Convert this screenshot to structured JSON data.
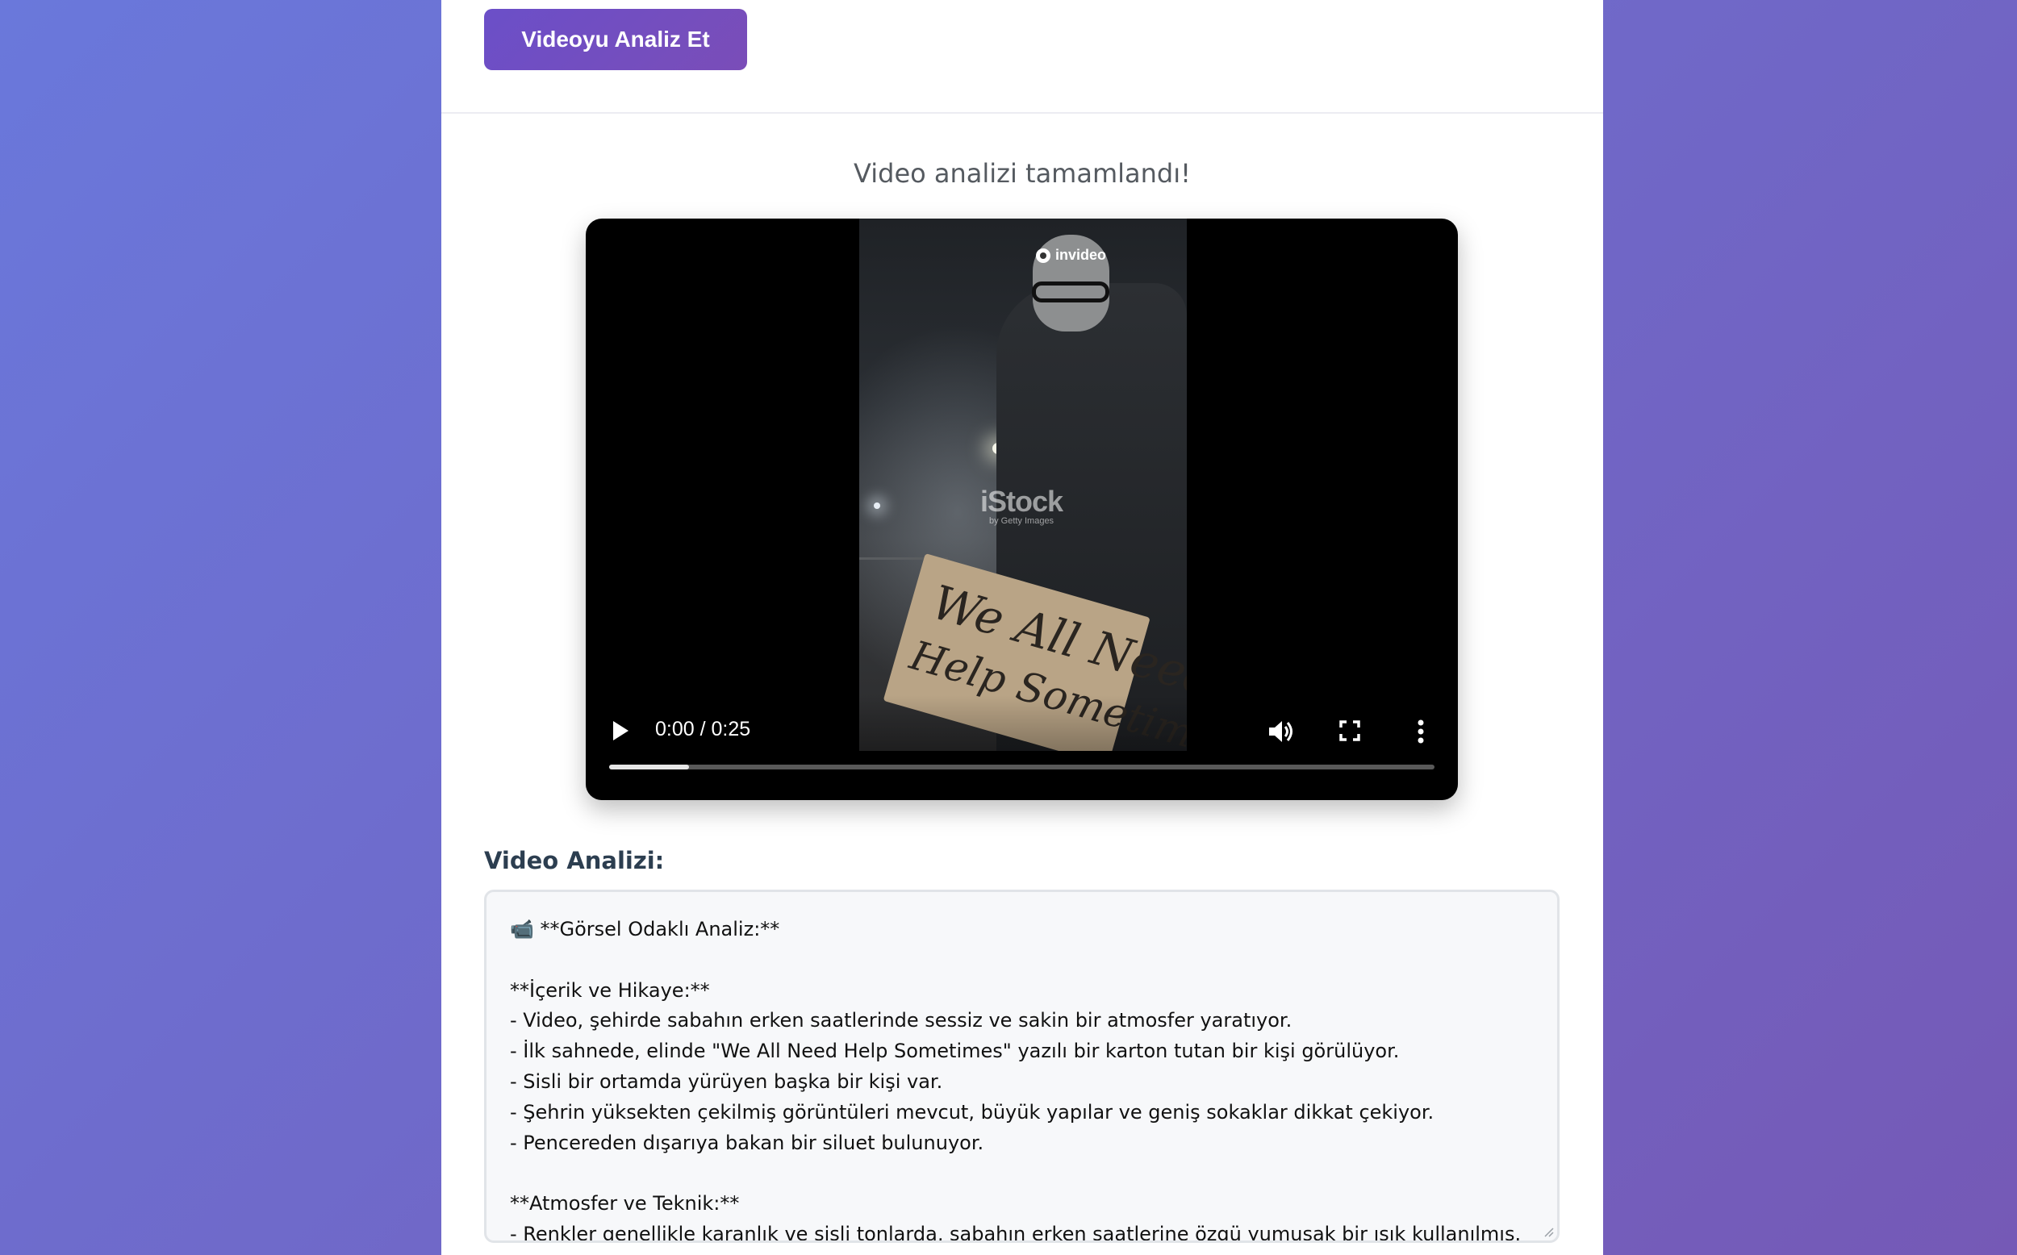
{
  "toolbar": {
    "analyze_button_label": "Videoyu Analiz Et"
  },
  "status": {
    "message": "Video analizi tamamlandı!"
  },
  "video": {
    "brand_label": "invideo",
    "watermark_main": "iStock",
    "watermark_sub": "by Getty Images",
    "sign_line1": "We All Need",
    "sign_line2": "Help Sometimes",
    "time_display": "0:00 / 0:25",
    "progress_buffered_fraction": 0.097,
    "icons": [
      "play-icon",
      "volume-icon",
      "fullscreen-icon",
      "more-options-icon"
    ]
  },
  "analysis": {
    "title": "Video Analizi:",
    "lines": [
      "📹 **Görsel Odaklı Analiz:**",
      "",
      "**İçerik ve Hikaye:**",
      "- Video, şehirde sabahın erken saatlerinde sessiz ve sakin bir atmosfer yaratıyor.",
      "- İlk sahnede, elinde \"We All Need Help Sometimes\" yazılı bir karton tutan bir kişi görülüyor.",
      "- Sisli bir ortamda yürüyen başka bir kişi var.",
      "- Şehrin yüksekten çekilmiş görüntüleri mevcut, büyük yapılar ve geniş sokaklar dikkat çekiyor.",
      "- Pencereden dışarıya bakan bir siluet bulunuyor.",
      "",
      "**Atmosfer ve Teknik:**",
      "- Renkler genellikle karanlık ve sisli tonlarda, sabahın erken saatlerine özgü yumuşak bir ışık kullanılmış."
    ]
  },
  "colors": {
    "background_start": "#6a78db",
    "background_end": "#7559b6",
    "button_bg": "#6b4fc8",
    "title_color": "#2c3e50",
    "status_color": "#555a60"
  }
}
